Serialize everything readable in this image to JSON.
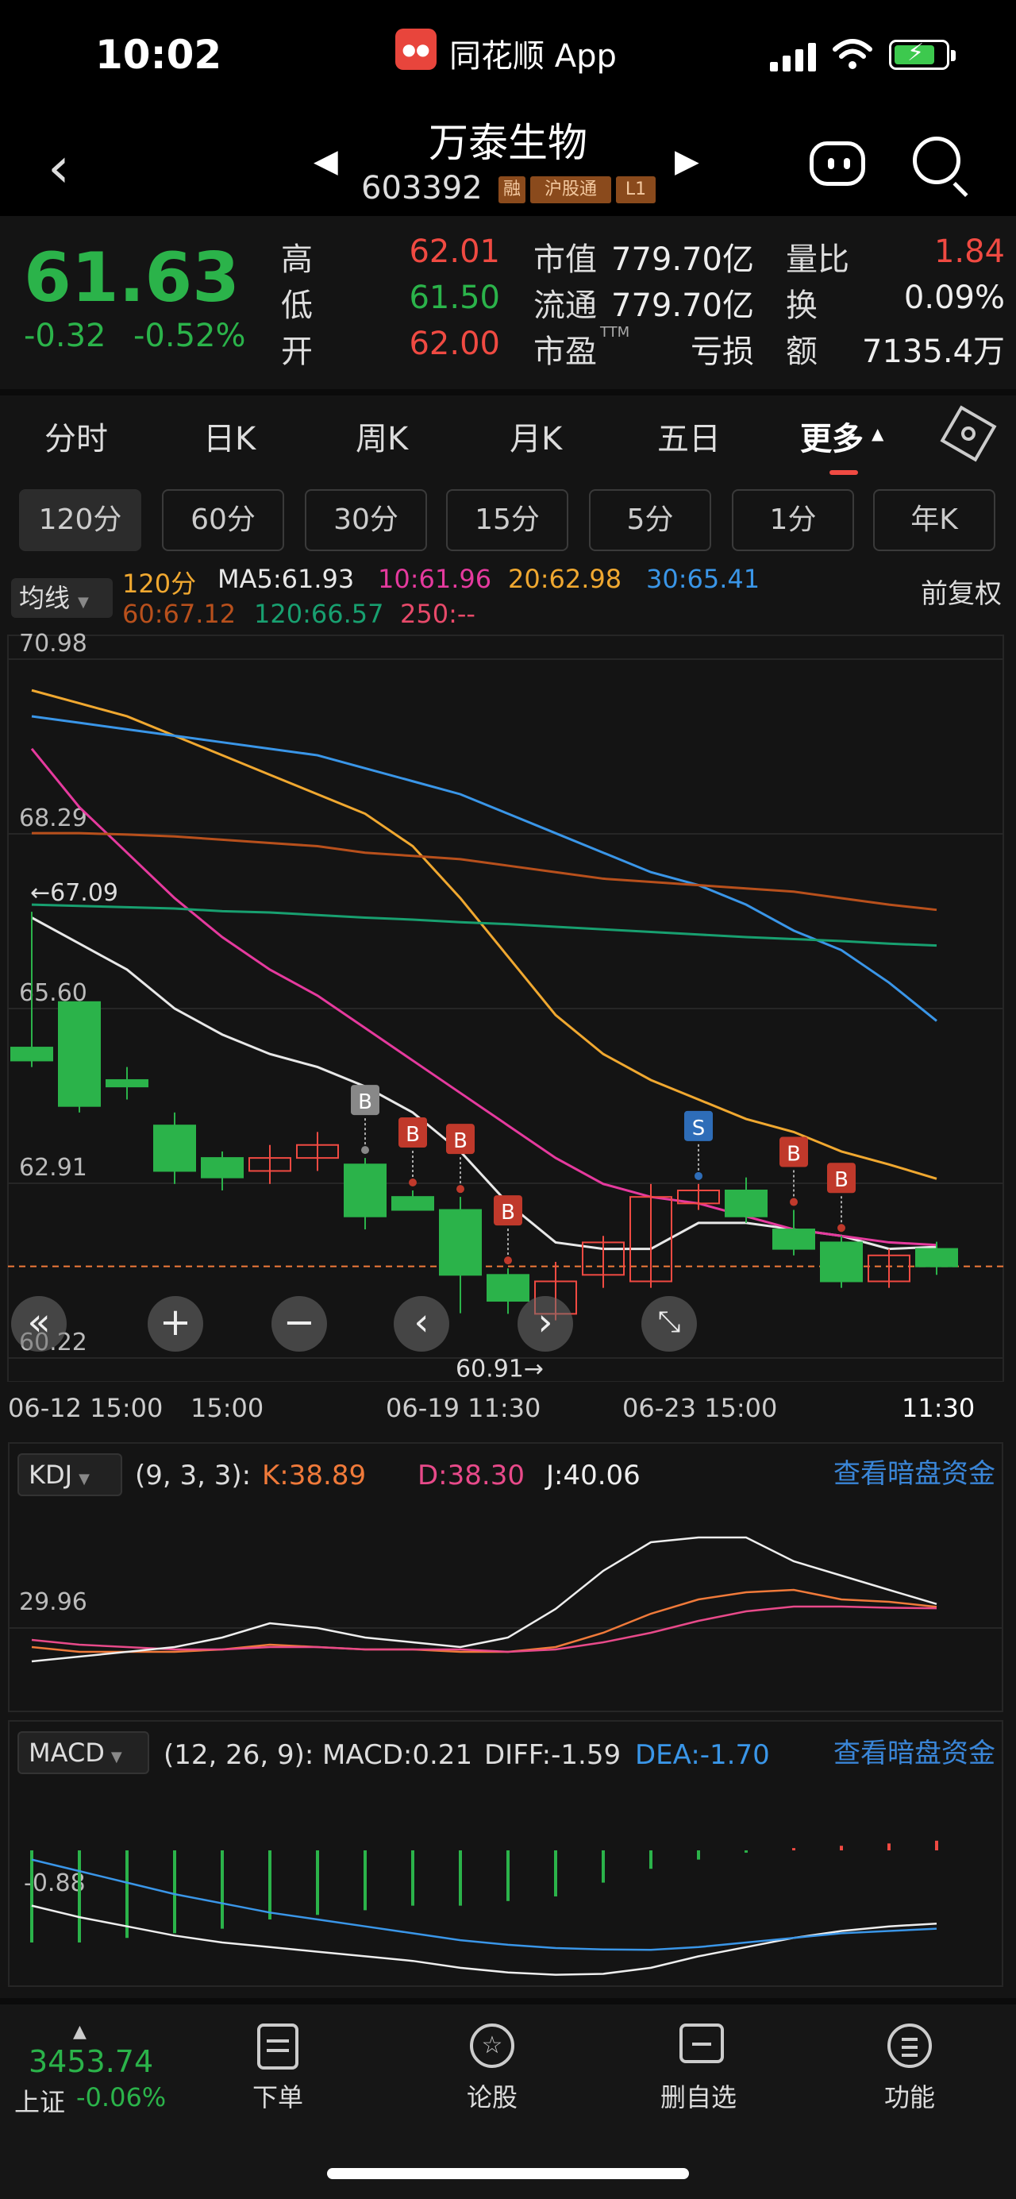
{
  "status_bar": {
    "time": "10:02",
    "app_name": "同花顺 App"
  },
  "header": {
    "stock_name": "万泰生物",
    "stock_code": "603392",
    "tags": [
      "融",
      "沪股通",
      "L1"
    ]
  },
  "quote": {
    "price": "61.63",
    "change": "-0.32",
    "change_pct": "-0.52%",
    "high_label": "高",
    "high": "62.01",
    "low_label": "低",
    "low": "61.50",
    "open_label": "开",
    "open": "62.00",
    "mktcap_label": "市值",
    "mktcap": "779.70亿",
    "float_label": "流通",
    "float": "779.70亿",
    "pe_label": "市盈",
    "pe_sup": "TTM",
    "pe": "亏损",
    "vol_ratio_label": "量比",
    "vol_ratio": "1.84",
    "turnover_label": "换",
    "turnover": "0.09%",
    "amount_label": "额",
    "amount": "7135.4万"
  },
  "tabs": {
    "items": [
      "分时",
      "日K",
      "周K",
      "月K",
      "五日",
      "更多"
    ],
    "active": "更多"
  },
  "periods": [
    "120分",
    "60分",
    "30分",
    "15分",
    "5分",
    "1分",
    "年K"
  ],
  "ma_bar": {
    "selector": "均线",
    "period": "120分",
    "ma5": "MA5:61.93",
    "ma10": "10:61.96",
    "ma20": "20:62.98",
    "ma30": "30:65.41",
    "ma60": "60:67.12",
    "ma120": "120:66.57",
    "ma250": "250:--",
    "adjust": "前复权"
  },
  "colors": {
    "up": "#f04a42",
    "down": "#2bb34a",
    "ma5": "#e8e8e8",
    "ma10": "#e53a9e",
    "ma20": "#f0a830",
    "ma30": "#3a96e8",
    "ma60": "#b8501c",
    "ma120": "#18a070",
    "link": "#3a86d8"
  },
  "chart_data": {
    "type": "candlestick",
    "y_ticks": [
      "70.98",
      "68.29",
      "65.60",
      "62.91",
      "60.22"
    ],
    "ylim": [
      60.22,
      70.98
    ],
    "high_marker": "←67.09",
    "low_marker": "60.91→",
    "current_price_line": 61.63,
    "x_ticks": [
      "06-12 15:00",
      "15:00",
      "06-19 11:30",
      "06-23 15:00",
      "11:30"
    ],
    "candles": [
      {
        "o": 65.0,
        "h": 67.09,
        "l": 64.7,
        "c": 64.8
      },
      {
        "o": 65.7,
        "h": 65.7,
        "l": 64.0,
        "c": 64.1
      },
      {
        "o": 64.5,
        "h": 64.7,
        "l": 64.2,
        "c": 64.4
      },
      {
        "o": 63.8,
        "h": 64.0,
        "l": 62.9,
        "c": 63.1
      },
      {
        "o": 63.3,
        "h": 63.4,
        "l": 62.8,
        "c": 63.0
      },
      {
        "o": 63.1,
        "h": 63.5,
        "l": 62.9,
        "c": 63.3
      },
      {
        "o": 63.3,
        "h": 63.7,
        "l": 63.1,
        "c": 63.5
      },
      {
        "o": 63.2,
        "h": 63.3,
        "l": 62.2,
        "c": 62.4
      },
      {
        "o": 62.7,
        "h": 62.8,
        "l": 62.5,
        "c": 62.5
      },
      {
        "o": 62.5,
        "h": 62.7,
        "l": 60.91,
        "c": 61.5
      },
      {
        "o": 61.5,
        "h": 61.6,
        "l": 60.9,
        "c": 61.1
      },
      {
        "o": 60.9,
        "h": 61.7,
        "l": 60.8,
        "c": 61.4
      },
      {
        "o": 61.5,
        "h": 62.1,
        "l": 61.3,
        "c": 62.0
      },
      {
        "o": 61.4,
        "h": 62.9,
        "l": 61.3,
        "c": 62.7
      },
      {
        "o": 62.6,
        "h": 62.9,
        "l": 62.5,
        "c": 62.8
      },
      {
        "o": 62.8,
        "h": 63.0,
        "l": 62.3,
        "c": 62.4
      },
      {
        "o": 62.2,
        "h": 62.5,
        "l": 61.8,
        "c": 61.9
      },
      {
        "o": 62.0,
        "h": 62.1,
        "l": 61.3,
        "c": 61.4
      },
      {
        "o": 61.4,
        "h": 61.9,
        "l": 61.3,
        "c": 61.8
      },
      {
        "o": 61.9,
        "h": 62.01,
        "l": 61.5,
        "c": 61.63
      }
    ],
    "signals": [
      {
        "i": 7,
        "label": "B",
        "color": "#888888"
      },
      {
        "i": 8,
        "label": "B",
        "color": "#c0392b"
      },
      {
        "i": 9,
        "label": "B",
        "color": "#c0392b"
      },
      {
        "i": 10,
        "label": "B",
        "color": "#c0392b"
      },
      {
        "i": 14,
        "label": "S",
        "color": "#2e6db8"
      },
      {
        "i": 16,
        "label": "B",
        "color": "#c0392b"
      },
      {
        "i": 17,
        "label": "B",
        "color": "#c0392b"
      }
    ],
    "series": [
      {
        "name": "MA5",
        "values": [
          67.0,
          66.6,
          66.2,
          65.6,
          65.2,
          64.9,
          64.7,
          64.4,
          64.0,
          63.4,
          62.6,
          62.0,
          61.9,
          61.9,
          62.3,
          62.3,
          62.2,
          62.1,
          61.9,
          61.93
        ]
      },
      {
        "name": "10",
        "values": [
          69.6,
          68.7,
          68.0,
          67.3,
          66.7,
          66.2,
          65.8,
          65.3,
          64.8,
          64.3,
          63.8,
          63.3,
          62.9,
          62.7,
          62.6,
          62.4,
          62.2,
          62.1,
          62.0,
          61.96
        ]
      },
      {
        "name": "20",
        "values": [
          70.5,
          70.3,
          70.1,
          69.8,
          69.5,
          69.2,
          68.9,
          68.6,
          68.1,
          67.3,
          66.4,
          65.5,
          64.9,
          64.5,
          64.2,
          63.9,
          63.7,
          63.4,
          63.2,
          62.98
        ]
      },
      {
        "name": "30",
        "values": [
          70.1,
          70.0,
          69.9,
          69.8,
          69.7,
          69.6,
          69.5,
          69.3,
          69.1,
          68.9,
          68.6,
          68.3,
          68.0,
          67.7,
          67.5,
          67.2,
          66.8,
          66.5,
          66.0,
          65.41
        ]
      },
      {
        "name": "60",
        "values": [
          68.3,
          68.3,
          68.28,
          68.25,
          68.2,
          68.15,
          68.1,
          68.0,
          67.95,
          67.9,
          67.8,
          67.7,
          67.6,
          67.55,
          67.5,
          67.45,
          67.4,
          67.3,
          67.2,
          67.12
        ]
      },
      {
        "name": "120",
        "values": [
          67.2,
          67.18,
          67.16,
          67.14,
          67.1,
          67.08,
          67.04,
          67.0,
          66.97,
          66.93,
          66.9,
          66.86,
          66.82,
          66.78,
          66.74,
          66.7,
          66.67,
          66.64,
          66.6,
          66.57
        ]
      }
    ]
  },
  "kdj": {
    "selector": "KDJ",
    "params": "(9, 3, 3):",
    "k": "K:38.89",
    "d": "D:38.30",
    "j": "J:40.06",
    "tick": "29.96",
    "link": "查看暗盘资金",
    "series": {
      "K": [
        22,
        20,
        20,
        20,
        21,
        23,
        22,
        21,
        21,
        20,
        20,
        22,
        28,
        36,
        42,
        45,
        46,
        42,
        41,
        38.89
      ],
      "D": [
        25,
        23,
        22,
        21,
        21,
        22,
        22,
        21,
        21,
        21,
        20,
        21,
        24,
        28,
        33,
        37,
        39,
        39,
        38.5,
        38.3
      ],
      "J": [
        16,
        18,
        20,
        22,
        26,
        32,
        30,
        26,
        24,
        22,
        26,
        38,
        54,
        66,
        68,
        68,
        58,
        52,
        46,
        40.06
      ]
    }
  },
  "macd": {
    "selector": "MACD",
    "params": "(12, 26, 9):",
    "macd": "MACD:0.21",
    "diff": "DIFF:-1.59",
    "dea": "DEA:-1.70",
    "tick": "-0.88",
    "link": "查看暗盘资金",
    "series": {
      "DIFF": [
        -1.2,
        -1.45,
        -1.65,
        -1.85,
        -2.0,
        -2.1,
        -2.2,
        -2.3,
        -2.4,
        -2.55,
        -2.65,
        -2.7,
        -2.68,
        -2.55,
        -2.3,
        -2.1,
        -1.9,
        -1.75,
        -1.65,
        -1.59
      ],
      "DEA": [
        -0.2,
        -0.45,
        -0.7,
        -0.95,
        -1.15,
        -1.35,
        -1.5,
        -1.65,
        -1.8,
        -1.95,
        -2.05,
        -2.12,
        -2.15,
        -2.16,
        -2.1,
        -2.0,
        -1.9,
        -1.8,
        -1.75,
        -1.7
      ],
      "MACD": [
        -2.0,
        -2.0,
        -1.9,
        -1.8,
        -1.7,
        -1.5,
        -1.4,
        -1.3,
        -1.2,
        -1.2,
        -1.1,
        -1.0,
        -0.7,
        -0.4,
        -0.2,
        -0.05,
        0.05,
        0.1,
        0.15,
        0.21
      ]
    }
  },
  "bottom_nav": {
    "index_value": "3453.74",
    "index_name": "上证",
    "index_change": "-0.06%",
    "items": [
      "下单",
      "论股",
      "删自选",
      "功能"
    ]
  }
}
